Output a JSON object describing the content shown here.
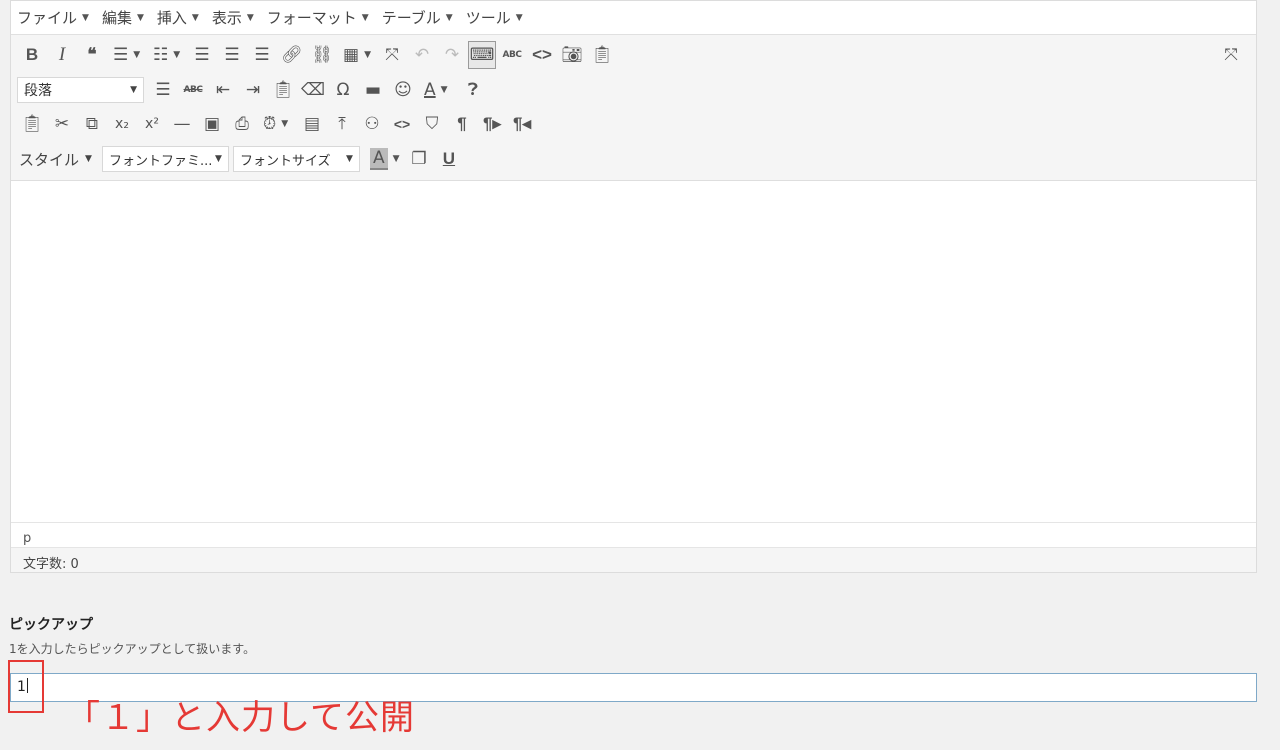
{
  "menubar": {
    "items": [
      {
        "label": "ファイル"
      },
      {
        "label": "編集"
      },
      {
        "label": "挿入"
      },
      {
        "label": "表示"
      },
      {
        "label": "フォーマット"
      },
      {
        "label": "テーブル"
      },
      {
        "label": "ツール"
      }
    ]
  },
  "toolbar": {
    "bold": "B",
    "italic": "I",
    "blockquote": "❝",
    "paragraph_select": "段落",
    "font_color": "A",
    "spellcheck": "ABC",
    "strikethrough": "ABC",
    "subscript": "x₂",
    "superscript": "x²",
    "styles_label": "スタイル",
    "font_family": "フォントファミ...",
    "font_size": "フォントサイズ",
    "bg_color": "A",
    "underline": "U"
  },
  "editor": {
    "path": "p",
    "word_count": "文字数: 0"
  },
  "field": {
    "title": "ピックアップ",
    "description": "1を入力したらピックアップとして扱います。",
    "value": "1"
  },
  "annotation": {
    "text": "「１」と入力して公開",
    "color": "#e53935"
  }
}
